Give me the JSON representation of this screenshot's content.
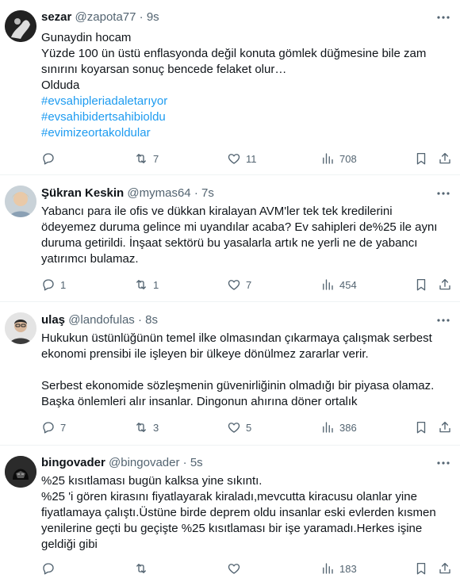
{
  "tweets": [
    {
      "name": "sezar",
      "handle": "@zapota77",
      "time": "9s",
      "lines": [
        "Gunaydin hocam",
        "Yüzde 100 ün üstü enflasyonda değil konuta gömlek düğmesine bile zam",
        "sınırını koyarsan sonuç bencede felaket olur…",
        "Olduda"
      ],
      "hashtags": [
        "#evsahipleriadaletarıyor",
        "#evsahibidertsahibioldu",
        "#evimizeortakoldular"
      ],
      "replies": "",
      "retweets": "7",
      "likes": "11",
      "views": "708"
    },
    {
      "name": "Şükran Keskin",
      "handle": "@mymas64",
      "time": "7s",
      "lines": [
        "Yabancı para ile ofis ve dükkan kiralayan AVM'ler tek tek kredilerini",
        "ödeyemez duruma gelince mi uyandılar acaba? Ev sahipleri de%25 ile aynı",
        "duruma getirildi. İnşaat sektörü bu yasalarla artık ne yerli ne de yabancı",
        "yatırımcı bulamaz."
      ],
      "replies": "1",
      "retweets": "1",
      "likes": "7",
      "views": "454"
    },
    {
      "name": "ulaş",
      "handle": "@landofulas",
      "time": "8s",
      "lines": [
        "Hukukun üstünlüğünün temel ilke olmasından çıkarmaya çalışmak serbest",
        "ekonomi prensibi ile işleyen bir ülkeye dönülmez zararlar verir.",
        "",
        "Serbest ekonomide sözleşmenin güvenirliğinin olmadığı bir piyasa olamaz.",
        "Başka önlemleri alır insanlar. Dingonun ahırına döner ortalık"
      ],
      "replies": "7",
      "retweets": "3",
      "likes": "5",
      "views": "386"
    },
    {
      "name": "bingovader",
      "handle": "@bingovader",
      "time": "5s",
      "lines": [
        "%25 kısıtlaması bugün kalksa yine sıkıntı.",
        "%25 'i gören kirasını fiyatlayarak kiraladı,mevcutta kiracusu olanlar yine",
        "fiyatlamaya çalıştı.Üstüne birde deprem oldu insanlar eski evlerden kısmen",
        "yenilerine geçti bu geçişte %25 kısıtlaması bir işe yaramadı.Herkes işine",
        "geldiği gibi"
      ],
      "replies": "",
      "retweets": "",
      "likes": "",
      "views": "183"
    }
  ],
  "separator": "·",
  "colors": {
    "text": "#0f1419",
    "secondary": "#536471",
    "link": "#1d9bf0",
    "border": "#eff3f4"
  },
  "icons": [
    "reply-icon",
    "retweet-icon",
    "like-icon",
    "views-icon",
    "bookmark-icon",
    "share-icon",
    "more-icon"
  ]
}
